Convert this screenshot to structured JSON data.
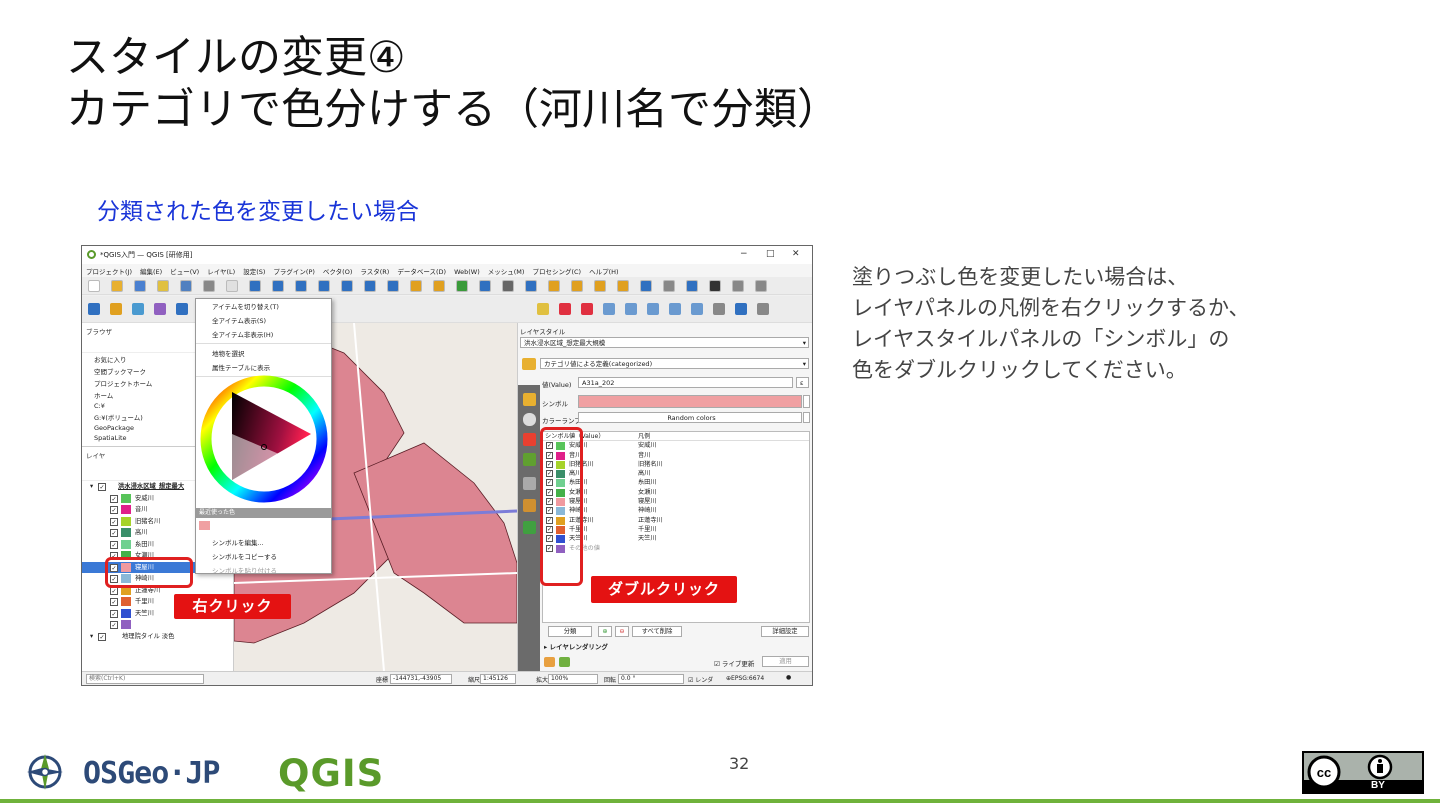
{
  "slide": {
    "title_line1": "スタイルの変更④",
    "title_line2": "カテゴリで色分けする（河川名で分類）",
    "subtitle": "分類された色を変更したい場合",
    "description": "塗りつぶし色を変更したい場合は、\nレイヤパネルの凡例を右クリックするか、\nレイヤスタイルパネルの「シンボル」の\n色をダブルクリックしてください。",
    "page_number": "32",
    "osgeo_logo": "OSGeo·JP",
    "qgis_logo": "QGIS",
    "license_badge": "BY"
  },
  "window": {
    "title": "*QGIS入門 — QGIS [研修用]",
    "minimize": "−",
    "maximize": "□",
    "close": "✕",
    "menu": [
      "プロジェクト(J)",
      "編集(E)",
      "ビュー(V)",
      "レイヤ(L)",
      "設定(S)",
      "プラグイン(P)",
      "ベクタ(O)",
      "ラスタ(R)",
      "データベース(D)",
      "Web(W)",
      "メッシュ(M)",
      "プロセシング(C)",
      "ヘルプ(H)"
    ]
  },
  "browser": {
    "title": "ブラウザ",
    "items": [
      "お気に入り",
      "空間ブックマーク",
      "プロジェクトホーム",
      "ホーム",
      "C:¥",
      "G:¥(ボリューム)",
      "GeoPackage",
      "SpatiaLite"
    ]
  },
  "layers": {
    "title": "レイヤ",
    "group_layer": "洪水浸水区域_想定最大",
    "items": [
      {
        "name": "安威川",
        "color": "#58c45a"
      },
      {
        "name": "音川",
        "color": "#e0208a"
      },
      {
        "name": "旧猪名川",
        "color": "#a6d32a"
      },
      {
        "name": "高川",
        "color": "#3a8f6a"
      },
      {
        "name": "糸田川",
        "color": "#70d090"
      },
      {
        "name": "女瀬川",
        "color": "#44b048"
      },
      {
        "name": "寝屋川",
        "color": "#f09aa0"
      },
      {
        "name": "神崎川",
        "color": "#8ab8d8"
      },
      {
        "name": "正蓮寺川",
        "color": "#e0a020"
      },
      {
        "name": "千里川",
        "color": "#e06030"
      },
      {
        "name": "天竺川",
        "color": "#3050d0"
      },
      {
        "name": "",
        "color": "#9060c0"
      }
    ],
    "selected_index": 6,
    "basemap": "地理院タイル 淡色"
  },
  "context_menu": {
    "items": [
      "アイテムを切り替え(T)",
      "全アイテム表示(S)",
      "全アイテム非表示(H)",
      "地物を選択",
      "属性テーブルに表示"
    ],
    "recent_colors": "最近使った色",
    "recent_color": "#f0a0a2",
    "actions": [
      "シンボルを編集...",
      "シンボルをコピーする",
      "シンボルを貼り付ける"
    ]
  },
  "style_panel": {
    "title": "レイヤスタイル",
    "layer": "洪水浸水区域_想定最大規模",
    "renderer": "カテゴリ値による定義(categorized)",
    "value_label": "値(Value)",
    "value_field": "A31a_202",
    "symbol_label": "シンボル",
    "symbol_color": "#f0a0a2",
    "ramp_label": "カラーランプ",
    "ramp_value": "Random colors",
    "col_symbol": "シンボル",
    "col_value": "値（Value）",
    "col_legend": "凡例",
    "rows": [
      {
        "value": "安威川",
        "legend": "安威川",
        "color": "#58c45a"
      },
      {
        "value": "音川",
        "legend": "音川",
        "color": "#e0208a"
      },
      {
        "value": "旧猪名川",
        "legend": "旧猪名川",
        "color": "#a6d32a"
      },
      {
        "value": "高川",
        "legend": "高川",
        "color": "#3a8f6a"
      },
      {
        "value": "糸田川",
        "legend": "糸田川",
        "color": "#70d090"
      },
      {
        "value": "女瀬川",
        "legend": "女瀬川",
        "color": "#44b048"
      },
      {
        "value": "寝屋川",
        "legend": "寝屋川",
        "color": "#f09aa0"
      },
      {
        "value": "神崎川",
        "legend": "神崎川",
        "color": "#8ab8d8"
      },
      {
        "value": "正蓮寺川",
        "legend": "正蓮寺川",
        "color": "#e0a020"
      },
      {
        "value": "千里川",
        "legend": "千里川",
        "color": "#e06030"
      },
      {
        "value": "天竺川",
        "legend": "天竺川",
        "color": "#3050d0"
      },
      {
        "value": "その他の値",
        "legend": "",
        "color": "#9060c0"
      }
    ],
    "classify_button": "分類",
    "delete_all_button": "すべて削除",
    "advanced_button": "詳細設定",
    "layer_rendering": "レイヤレンダリング",
    "live_update": "ライブ更新",
    "apply_button": "適用"
  },
  "statusbar": {
    "search_placeholder": "検索(Ctrl+K)",
    "coord_label": "座標",
    "coord_value": "-144731,-43905",
    "scale_label": "縮尺",
    "scale_value": "1:45126",
    "magnifier_label": "拡大",
    "magnifier_value": "100%",
    "rotation_label": "回転",
    "rotation_value": "0.0 °",
    "render_label": "レンダ",
    "crs": "EPSG:6674"
  },
  "annotations": {
    "right_click": "右クリック",
    "double_click": "ダブルクリック"
  }
}
